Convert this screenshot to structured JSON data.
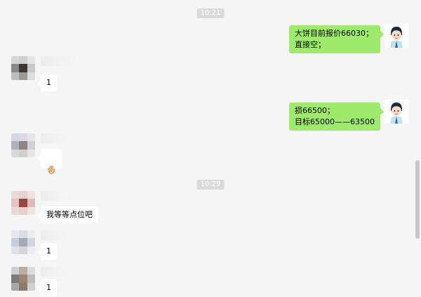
{
  "timestamps": [
    "10:21",
    "10:29"
  ],
  "messages": [
    {
      "side": "out",
      "text": "大饼目前报价66030；\n直接空；"
    },
    {
      "side": "in",
      "text": "1"
    },
    {
      "side": "out",
      "text": "损66500；\n目标65000——63500"
    },
    {
      "side": "in",
      "icon": "ok-hand-emoji-icon"
    },
    {
      "side": "in",
      "text": "我等等点位吧"
    },
    {
      "side": "in",
      "text": "1"
    },
    {
      "side": "in",
      "text": "1"
    }
  ],
  "colors": {
    "background": "#f5f5f5",
    "bubble_out": "#9eea6a",
    "bubble_in": "#ffffff",
    "timestamp_bg": "#dadada"
  }
}
